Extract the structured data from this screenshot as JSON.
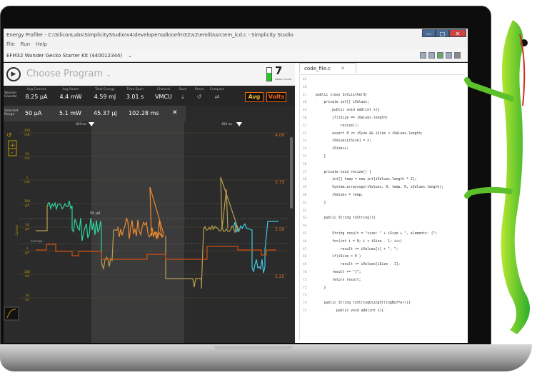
{
  "window": {
    "title": "Energy Profiler - C:\\SiliconLabs\\SimplicityStudio\\v4\\developer\\sdks\\efm32\\v2\\emlib\\src\\em_lcd.c - Simplicity Studio",
    "minimize": "—",
    "maximize": "□",
    "close": "✕"
  },
  "menu": [
    "File",
    "Run",
    "Help"
  ],
  "kit": {
    "label": "EFM32 Wonder Gecko Starter Kit (440012344)",
    "chevron": "⌄"
  },
  "program": {
    "play": "▶",
    "label": "Choose Program",
    "chevron": "⌄",
    "energy_score": "7",
    "energy_score_label": "ENERGY SCORE"
  },
  "session": {
    "row_label": "Session Counter",
    "avg_current_label": "Avg Current",
    "avg_current": "8.25 µA",
    "avg_power_label": "Avg Power",
    "avg_power": "4.4 mW",
    "total_energy_label": "Total Energy",
    "total_energy": "4.59 mJ",
    "time_span_label": "Time Span",
    "time_span": "3.01 s",
    "channel_label": "Channel",
    "channel": "VMCU",
    "save_label": "Save",
    "reset_label": "Reset",
    "compare_label": "Compare",
    "avg_button": "Avg",
    "volts_button": "Volts"
  },
  "selected": {
    "row_label": "Selected Range",
    "current": "50 µA",
    "power": "5.1 mW",
    "energy": "45.37 µJ",
    "time": "102.28 ms",
    "close": "✕"
  },
  "chart": {
    "marker_left": "-820 ms",
    "marker_right": "-650 ms",
    "y_label": "Current",
    "left_ticks": [
      "100 mA",
      "10 mA",
      "1 mA",
      "100 µA",
      "10 µA",
      "1 µA",
      "100 nA",
      "10 nA"
    ],
    "right_ticks": [
      "4.00",
      "3.75",
      "3.50",
      "3.25"
    ],
    "threshold_label": "50 µA",
    "average_label": "Average",
    "colors": {
      "green": "#2fd3a0",
      "orange": "#f08a30",
      "gold": "#b8a050",
      "cyan": "#40c8e8",
      "avg": "#d05010",
      "axis": "#e07020"
    }
  },
  "editor": {
    "tab": "code_file.c",
    "tab_close": "✕",
    "lines": [
      {
        "n": "45",
        "t": ""
      },
      {
        "n": "46",
        "t": ""
      },
      {
        "n": "47",
        "t": "public class IntListVer3{"
      },
      {
        "n": "48",
        "t": "    private int[] iValues;"
      },
      {
        "n": "49",
        "t": "        public void add(int x){"
      },
      {
        "n": "50",
        "t": "        if(iSize == iValues.length)"
      },
      {
        "n": "51",
        "t": "            resize();"
      },
      {
        "n": "52",
        "t": "        assert 0 <= iSize && iSize < iValues.length;"
      },
      {
        "n": "53",
        "t": "        iValues[iSize] = x;"
      },
      {
        "n": "54",
        "t": "        iSize++;"
      },
      {
        "n": "55",
        "t": "    }"
      },
      {
        "n": "56",
        "t": ""
      },
      {
        "n": "57",
        "t": "    private void resize() {"
      },
      {
        "n": "58",
        "t": "        int[] temp = new int[iValues.length * 2];"
      },
      {
        "n": "59",
        "t": "        System.arraycopy(iValues, 0, temp, 0, iValues.length);"
      },
      {
        "n": "60",
        "t": "        iValues = temp;"
      },
      {
        "n": "61",
        "t": "    }"
      },
      {
        "n": "62",
        "t": ""
      },
      {
        "n": "63",
        "t": "    public String toString(){"
      },
      {
        "n": "64",
        "t": ""
      },
      {
        "n": "65",
        "t": "        String result = \"size: \" + iSize + \", elements: [\";"
      },
      {
        "n": "66",
        "t": "        for(int i = 0; i < iSize - 1; i++)"
      },
      {
        "n": "67",
        "t": "            result += iValues[i] + \", \";"
      },
      {
        "n": "68",
        "t": "        if(iSize > 0 )"
      },
      {
        "n": "69",
        "t": "            result += iValues[iSize - 1];"
      },
      {
        "n": "70",
        "t": "        result += \"]\";"
      },
      {
        "n": "71",
        "t": "        return result;"
      },
      {
        "n": "72",
        "t": "    }"
      },
      {
        "n": "73",
        "t": ""
      },
      {
        "n": "74",
        "t": "    public String toStringUsingStringBuffer(){"
      },
      {
        "n": "75",
        "t": "          public void add(int x){"
      }
    ]
  }
}
